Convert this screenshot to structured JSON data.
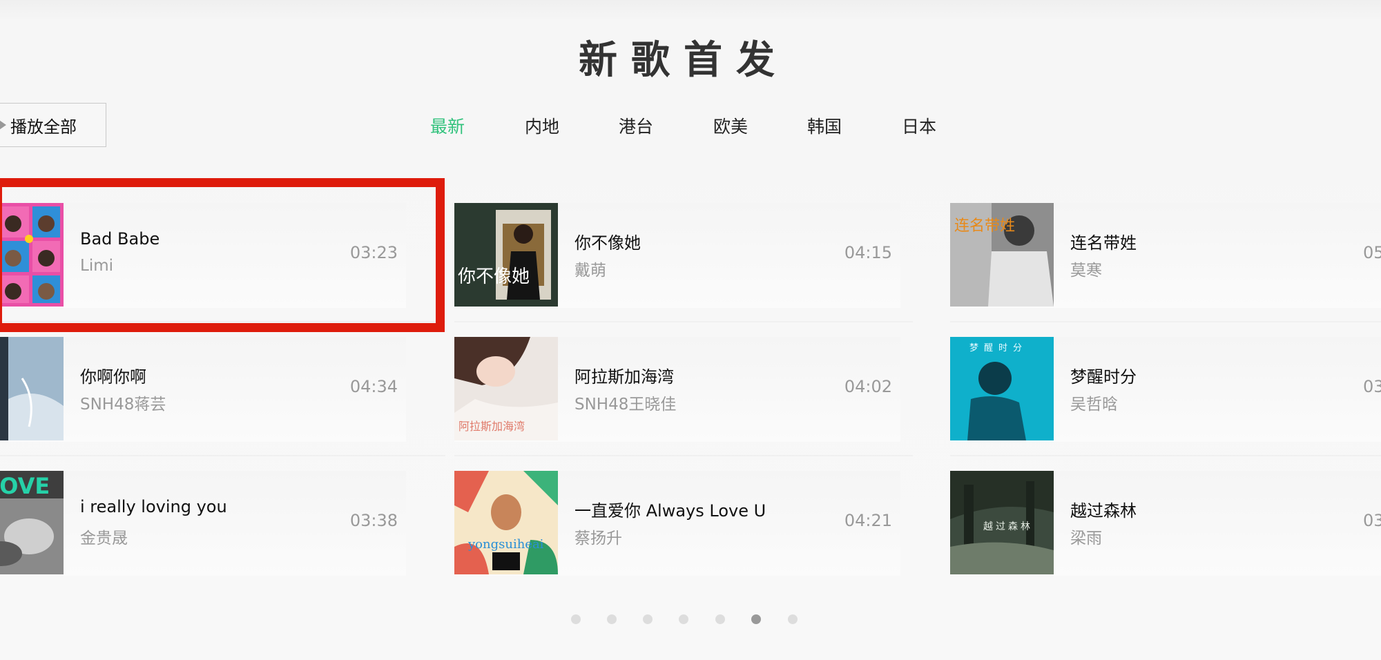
{
  "header": {
    "title": "新歌首发"
  },
  "play_all": {
    "label": "播放全部",
    "icon": "play-icon"
  },
  "tabs": [
    {
      "label": "最新",
      "active": true
    },
    {
      "label": "内地",
      "active": false
    },
    {
      "label": "港台",
      "active": false
    },
    {
      "label": "欧美",
      "active": false
    },
    {
      "label": "韩国",
      "active": false
    },
    {
      "label": "日本",
      "active": false
    }
  ],
  "accent_color": "#31c27c",
  "highlight_color": "#de1c0c",
  "songs": [
    {
      "title": "Bad Babe",
      "singer": "Limi",
      "duration": "03:23"
    },
    {
      "title": "你不像她",
      "singer": "戴萌",
      "duration": "04:15"
    },
    {
      "title": "连名带姓",
      "singer": "莫寒",
      "duration": "05"
    },
    {
      "title": "你啊你啊",
      "singer": "SNH48蒋芸",
      "duration": "04:34"
    },
    {
      "title": "阿拉斯加海湾",
      "singer": "SNH48王晓佳",
      "duration": "04:02"
    },
    {
      "title": "梦醒时分",
      "singer": "吴哲晗",
      "duration": "03"
    },
    {
      "title": "i really loving you",
      "singer": "金贵晟",
      "duration": "03:38"
    },
    {
      "title": "一直爱你 Always Love U",
      "singer": "蔡扬升",
      "duration": "04:21"
    },
    {
      "title": "越过森林",
      "singer": "梁雨",
      "duration": "03"
    }
  ],
  "covers": {
    "c1": {
      "text": ""
    },
    "c2": {
      "text": "你不像她"
    },
    "c3": {
      "text": "连名带姓"
    },
    "c4": {
      "text": ""
    },
    "c5": {
      "text": "阿拉斯加海湾"
    },
    "c6": {
      "text": "梦醒时分"
    },
    "c7": {
      "text": "LOVE"
    },
    "c8": {
      "text": "yongsuiheai"
    },
    "c9": {
      "text": "越过森林"
    }
  },
  "pagination": {
    "count": 7,
    "active_index": 5
  }
}
